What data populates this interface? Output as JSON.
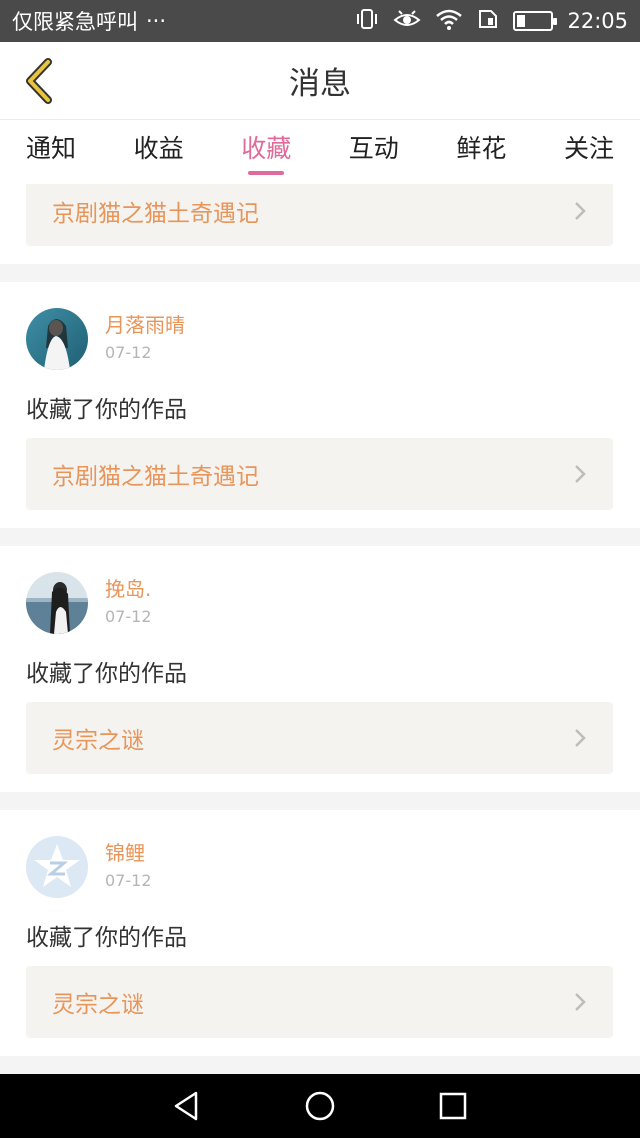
{
  "status_bar": {
    "carrier_text": "仅限紧急呼叫",
    "more": "···",
    "time": "22:05",
    "battery_level": 0.25,
    "icons": [
      "vibrate-icon",
      "eye-icon",
      "wifi-icon",
      "sim-icon",
      "battery-icon"
    ]
  },
  "header": {
    "title": "消息",
    "back_icon": "chevron-left-icon",
    "accent_color": "#e8c53a"
  },
  "tabs": [
    {
      "label": "通知",
      "active": false
    },
    {
      "label": "收益",
      "active": false
    },
    {
      "label": "收藏",
      "active": true
    },
    {
      "label": "互动",
      "active": false
    },
    {
      "label": "鲜花",
      "active": false
    },
    {
      "label": "关注",
      "active": false
    }
  ],
  "colors": {
    "active_tab": "#e06a9a",
    "username": "#e8955a",
    "work_title": "#e8955a",
    "date": "#b5b5b5"
  },
  "partial_item": {
    "work_title": "京剧猫之猫土奇遇记"
  },
  "items": [
    {
      "username": "月落雨晴",
      "date": "07-12",
      "action": "收藏了你的作品",
      "work_title": "京剧猫之猫土奇遇记",
      "avatar_icon": "user-photo-avatar"
    },
    {
      "username": "挽岛.",
      "date": "07-12",
      "action": "收藏了你的作品",
      "work_title": "灵宗之谜",
      "avatar_icon": "user-photo-avatar"
    },
    {
      "username": "锦鲤",
      "date": "07-12",
      "action": "收藏了你的作品",
      "work_title": "灵宗之谜",
      "avatar_icon": "qq-default-avatar"
    }
  ],
  "nav_bar": {
    "icons": [
      "back-triangle-icon",
      "home-circle-icon",
      "recents-square-icon"
    ]
  }
}
